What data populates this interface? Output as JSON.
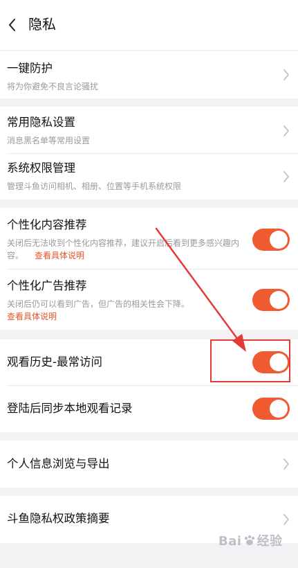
{
  "header": {
    "title": "隐私"
  },
  "sections": {
    "protection": {
      "title": "一键防护",
      "subtitle": "将为你避免不良言论骚扰"
    },
    "common": {
      "title": "常用隐私设置",
      "subtitle": "消息黑名单等常用设置"
    },
    "permissions": {
      "title": "系统权限管理",
      "subtitle": "管理斗鱼访问相机、相册、位置等手机系统权限"
    },
    "personalized_content": {
      "title": "个性化内容推荐",
      "description": "关闭后无法收到个性化内容推荐，建议开启后看到更多感兴趣内容。",
      "link": "查看具体说明",
      "enabled": true
    },
    "personalized_ads": {
      "title": "个性化广告推荐",
      "description": "关闭后仍可以看到广告，但广告的相关性会下降。",
      "link": "查看具体说明",
      "enabled": true
    },
    "watch_history": {
      "title": "观看历史-最常访问",
      "enabled": true
    },
    "sync_history": {
      "title": "登陆后同步本地观看记录",
      "enabled": true
    },
    "personal_info": {
      "title": "个人信息浏览与导出"
    },
    "policy": {
      "title": "斗鱼隐私权政策摘要"
    }
  },
  "colors": {
    "accent": "#f05a31",
    "annotation": "#e53935",
    "background": "#f2f2f4"
  },
  "watermark": {
    "text_a": "Bai",
    "text_b": "经验"
  }
}
